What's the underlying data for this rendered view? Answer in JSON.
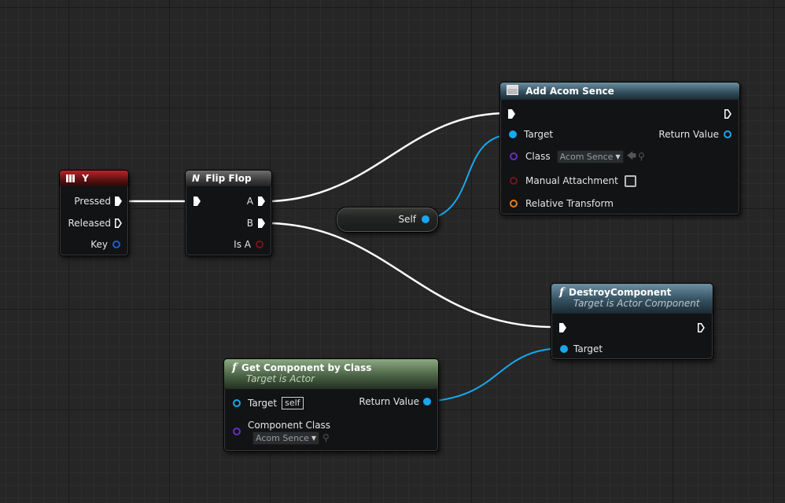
{
  "colors": {
    "exec": "#ffffff",
    "object_pin": "#19a7f0",
    "key_pin": "#1f5ed6",
    "bool_pin": "#a3121a",
    "class_pin": "#6a2bc7",
    "transform_pin": "#e0801f"
  },
  "input_y": {
    "title": "Y",
    "icon": "keyboard-icon",
    "pins": {
      "pressed": "Pressed",
      "released": "Released",
      "key": "Key"
    }
  },
  "flip_flop": {
    "title": "Flip Flop",
    "icon": "flipflop-icon",
    "pins": {
      "a": "A",
      "b": "B",
      "is_a": "Is A"
    }
  },
  "add_acom": {
    "title": "Add Acom Sence",
    "icon": "component-icon",
    "pins": {
      "target": "Target",
      "return_value": "Return Value",
      "class": "Class",
      "class_value": "Acom Sence",
      "manual_attachment": "Manual Attachment",
      "relative_transform": "Relative Transform"
    }
  },
  "self_node": {
    "label": "Self"
  },
  "destroy": {
    "title": "DestroyComponent",
    "subtitle": "Target is Actor Component",
    "icon": "function-icon",
    "pins": {
      "target": "Target"
    }
  },
  "get_component": {
    "title": "Get Component by Class",
    "subtitle": "Target is Actor",
    "icon": "function-icon",
    "pins": {
      "target": "Target",
      "target_value": "self",
      "return_value": "Return Value",
      "component_class": "Component Class",
      "component_class_value": "Acom Sence"
    }
  }
}
